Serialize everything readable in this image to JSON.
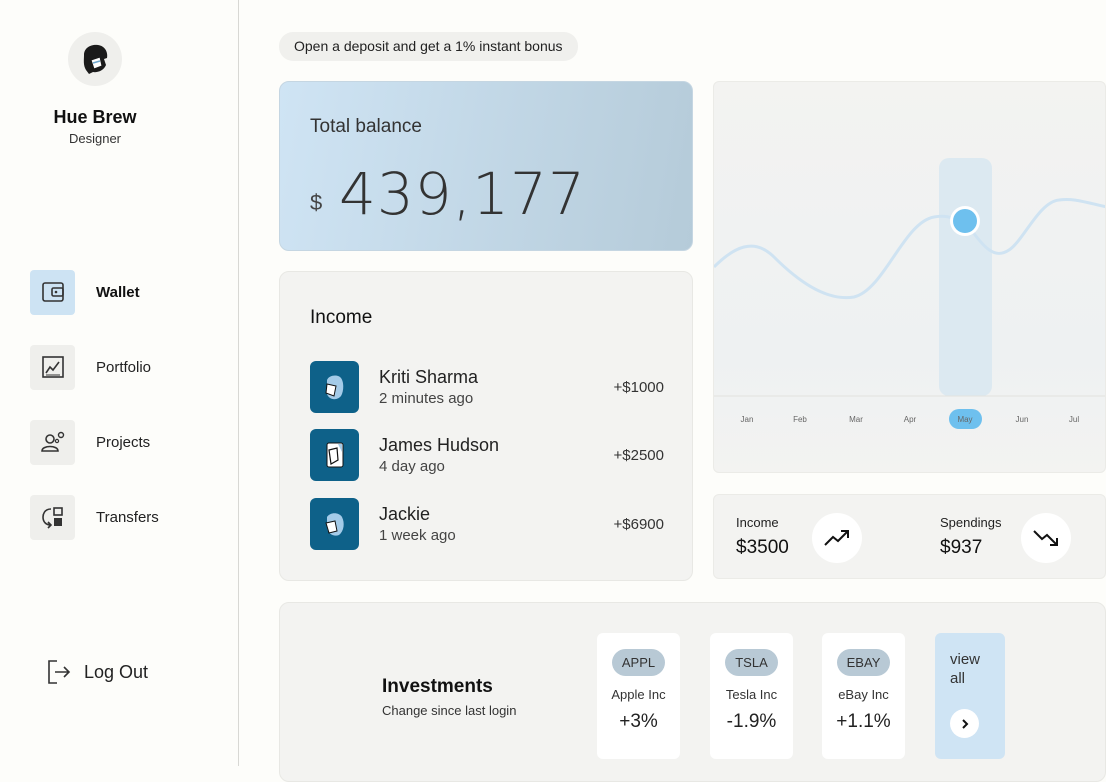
{
  "user": {
    "name": "Hue Brew",
    "role": "Designer"
  },
  "nav": [
    {
      "label": "Wallet",
      "icon": "wallet-icon",
      "active": true
    },
    {
      "label": "Portfolio",
      "icon": "chart-icon",
      "active": false
    },
    {
      "label": "Projects",
      "icon": "projects-icon",
      "active": false
    },
    {
      "label": "Transfers",
      "icon": "transfers-icon",
      "active": false
    }
  ],
  "logout_label": "Log Out",
  "promo": "Open a deposit and get a 1% instant bonus",
  "balance": {
    "title": "Total balance",
    "currency": "$",
    "value": "439,177"
  },
  "income": {
    "title": "Income",
    "items": [
      {
        "name": "Kriti Sharma",
        "time": "2 minutes ago",
        "amount": "+$1000"
      },
      {
        "name": "James Hudson",
        "time": "4 day ago",
        "amount": "+$2500"
      },
      {
        "name": "Jackie",
        "time": "1 week ago",
        "amount": "+$6900"
      }
    ]
  },
  "chart_data": {
    "type": "line",
    "categories": [
      "Jan",
      "Feb",
      "Mar",
      "Apr",
      "May",
      "Jun",
      "Jul"
    ],
    "selected": "May",
    "colors": {
      "line": "#cfe3f2",
      "highlight": "#dce9f1",
      "point": "#6ec0ee",
      "selected_label_bg": "#6ec0ee"
    }
  },
  "stats": {
    "income_label": "Income",
    "income_value": "$3500",
    "spend_label": "Spendings",
    "spend_value": "$937"
  },
  "investments": {
    "title": "Investments",
    "subtitle": "Change since last login",
    "stocks": [
      {
        "ticker": "APPL",
        "name": "Apple Inc",
        "change": "+3%"
      },
      {
        "ticker": "TSLA",
        "name": "Tesla Inc",
        "change": "-1.9%"
      },
      {
        "ticker": "EBAY",
        "name": "eBay Inc",
        "change": "+1.1%"
      }
    ],
    "view_all": "view all"
  }
}
